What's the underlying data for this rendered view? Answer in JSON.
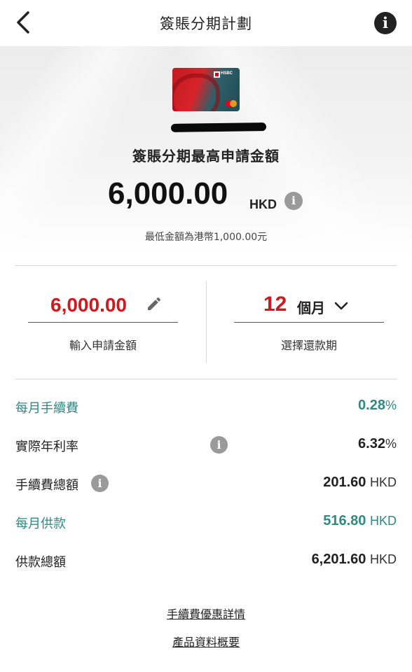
{
  "header": {
    "title": "簽賬分期計劃",
    "back_icon": "chevron-left-icon",
    "info_icon": "info-icon"
  },
  "hero": {
    "card_brand": "HSBC",
    "max_label": "簽賬分期最高申請金額",
    "max_amount": "6,000.00",
    "currency": "HKD",
    "min_note": "最低金額為港幣1,000.00元"
  },
  "form": {
    "amount_value": "6,000.00",
    "amount_label": "輸入申請金額",
    "term_number": "12",
    "term_unit": "個月",
    "term_label": "選擇還款期"
  },
  "details": {
    "monthly_fee_label": "每月手續費",
    "monthly_fee_value": "0.28",
    "monthly_fee_unit": "%",
    "apr_label": "實際年利率",
    "apr_value": "6.32",
    "apr_unit": "%",
    "total_fee_label": "手續費總額",
    "total_fee_value": "201.60",
    "total_fee_unit": "HKD",
    "monthly_payment_label": "每月供款",
    "monthly_payment_value": "516.80",
    "monthly_payment_unit": "HKD",
    "total_payment_label": "供款總額",
    "total_payment_value": "6,201.60",
    "total_payment_unit": "HKD"
  },
  "links": {
    "fee_promo": "手續費優惠詳情",
    "product_info": "產品資料概要"
  },
  "colors": {
    "accent_red": "#d0191f",
    "teal": "#2e8a82",
    "info_grey": "#9a9a9a"
  }
}
